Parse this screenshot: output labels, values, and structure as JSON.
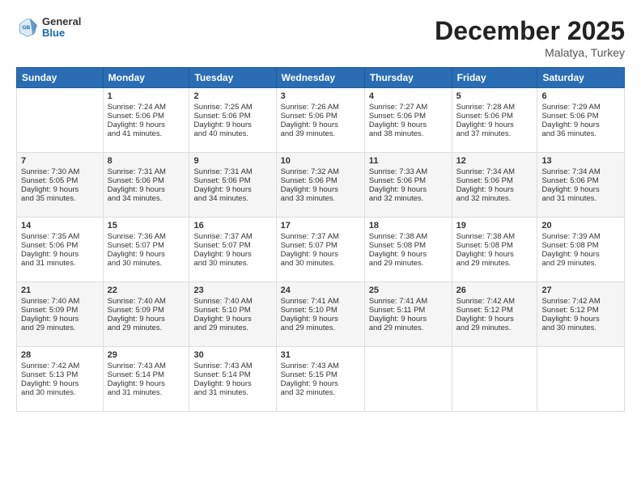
{
  "header": {
    "logo_general": "General",
    "logo_blue": "Blue",
    "month": "December 2025",
    "location": "Malatya, Turkey"
  },
  "weekdays": [
    "Sunday",
    "Monday",
    "Tuesday",
    "Wednesday",
    "Thursday",
    "Friday",
    "Saturday"
  ],
  "weeks": [
    [
      {
        "day": "",
        "info": ""
      },
      {
        "day": "1",
        "info": "Sunrise: 7:24 AM\nSunset: 5:06 PM\nDaylight: 9 hours\nand 41 minutes."
      },
      {
        "day": "2",
        "info": "Sunrise: 7:25 AM\nSunset: 5:06 PM\nDaylight: 9 hours\nand 40 minutes."
      },
      {
        "day": "3",
        "info": "Sunrise: 7:26 AM\nSunset: 5:06 PM\nDaylight: 9 hours\nand 39 minutes."
      },
      {
        "day": "4",
        "info": "Sunrise: 7:27 AM\nSunset: 5:06 PM\nDaylight: 9 hours\nand 38 minutes."
      },
      {
        "day": "5",
        "info": "Sunrise: 7:28 AM\nSunset: 5:06 PM\nDaylight: 9 hours\nand 37 minutes."
      },
      {
        "day": "6",
        "info": "Sunrise: 7:29 AM\nSunset: 5:06 PM\nDaylight: 9 hours\nand 36 minutes."
      }
    ],
    [
      {
        "day": "7",
        "info": "Sunrise: 7:30 AM\nSunset: 5:05 PM\nDaylight: 9 hours\nand 35 minutes."
      },
      {
        "day": "8",
        "info": "Sunrise: 7:31 AM\nSunset: 5:06 PM\nDaylight: 9 hours\nand 34 minutes."
      },
      {
        "day": "9",
        "info": "Sunrise: 7:31 AM\nSunset: 5:06 PM\nDaylight: 9 hours\nand 34 minutes."
      },
      {
        "day": "10",
        "info": "Sunrise: 7:32 AM\nSunset: 5:06 PM\nDaylight: 9 hours\nand 33 minutes."
      },
      {
        "day": "11",
        "info": "Sunrise: 7:33 AM\nSunset: 5:06 PM\nDaylight: 9 hours\nand 32 minutes."
      },
      {
        "day": "12",
        "info": "Sunrise: 7:34 AM\nSunset: 5:06 PM\nDaylight: 9 hours\nand 32 minutes."
      },
      {
        "day": "13",
        "info": "Sunrise: 7:34 AM\nSunset: 5:06 PM\nDaylight: 9 hours\nand 31 minutes."
      }
    ],
    [
      {
        "day": "14",
        "info": "Sunrise: 7:35 AM\nSunset: 5:06 PM\nDaylight: 9 hours\nand 31 minutes."
      },
      {
        "day": "15",
        "info": "Sunrise: 7:36 AM\nSunset: 5:07 PM\nDaylight: 9 hours\nand 30 minutes."
      },
      {
        "day": "16",
        "info": "Sunrise: 7:37 AM\nSunset: 5:07 PM\nDaylight: 9 hours\nand 30 minutes."
      },
      {
        "day": "17",
        "info": "Sunrise: 7:37 AM\nSunset: 5:07 PM\nDaylight: 9 hours\nand 30 minutes."
      },
      {
        "day": "18",
        "info": "Sunrise: 7:38 AM\nSunset: 5:08 PM\nDaylight: 9 hours\nand 29 minutes."
      },
      {
        "day": "19",
        "info": "Sunrise: 7:38 AM\nSunset: 5:08 PM\nDaylight: 9 hours\nand 29 minutes."
      },
      {
        "day": "20",
        "info": "Sunrise: 7:39 AM\nSunset: 5:08 PM\nDaylight: 9 hours\nand 29 minutes."
      }
    ],
    [
      {
        "day": "21",
        "info": "Sunrise: 7:40 AM\nSunset: 5:09 PM\nDaylight: 9 hours\nand 29 minutes."
      },
      {
        "day": "22",
        "info": "Sunrise: 7:40 AM\nSunset: 5:09 PM\nDaylight: 9 hours\nand 29 minutes."
      },
      {
        "day": "23",
        "info": "Sunrise: 7:40 AM\nSunset: 5:10 PM\nDaylight: 9 hours\nand 29 minutes."
      },
      {
        "day": "24",
        "info": "Sunrise: 7:41 AM\nSunset: 5:10 PM\nDaylight: 9 hours\nand 29 minutes."
      },
      {
        "day": "25",
        "info": "Sunrise: 7:41 AM\nSunset: 5:11 PM\nDaylight: 9 hours\nand 29 minutes."
      },
      {
        "day": "26",
        "info": "Sunrise: 7:42 AM\nSunset: 5:12 PM\nDaylight: 9 hours\nand 29 minutes."
      },
      {
        "day": "27",
        "info": "Sunrise: 7:42 AM\nSunset: 5:12 PM\nDaylight: 9 hours\nand 30 minutes."
      }
    ],
    [
      {
        "day": "28",
        "info": "Sunrise: 7:42 AM\nSunset: 5:13 PM\nDaylight: 9 hours\nand 30 minutes."
      },
      {
        "day": "29",
        "info": "Sunrise: 7:43 AM\nSunset: 5:14 PM\nDaylight: 9 hours\nand 31 minutes."
      },
      {
        "day": "30",
        "info": "Sunrise: 7:43 AM\nSunset: 5:14 PM\nDaylight: 9 hours\nand 31 minutes."
      },
      {
        "day": "31",
        "info": "Sunrise: 7:43 AM\nSunset: 5:15 PM\nDaylight: 9 hours\nand 32 minutes."
      },
      {
        "day": "",
        "info": ""
      },
      {
        "day": "",
        "info": ""
      },
      {
        "day": "",
        "info": ""
      }
    ]
  ]
}
